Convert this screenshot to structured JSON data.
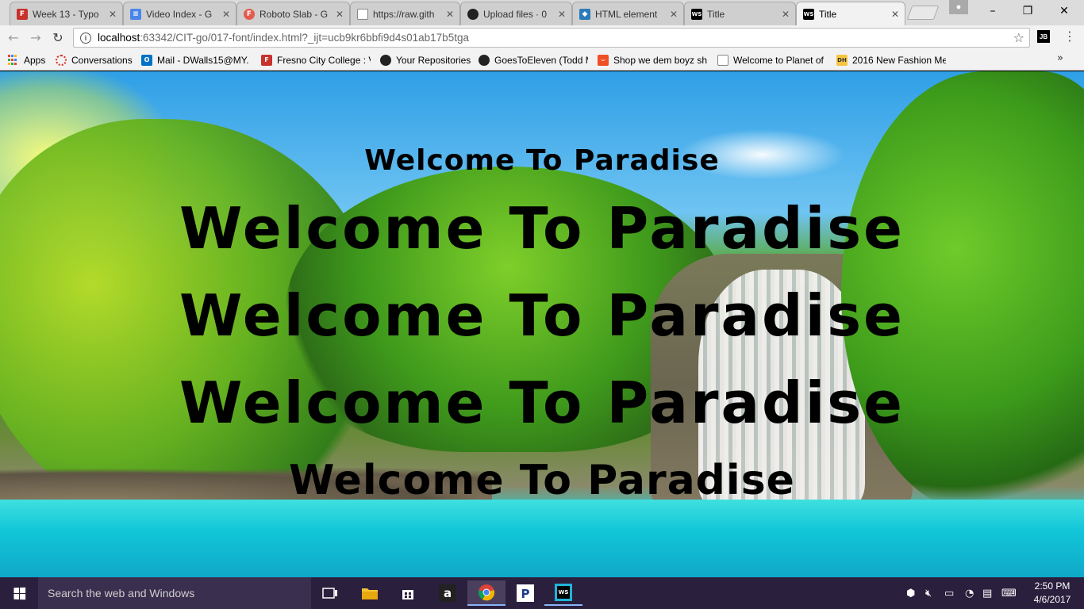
{
  "browser": {
    "tabs": [
      {
        "label": "Week 13 - Typo",
        "icon": "fcc-logo-icon",
        "active": false
      },
      {
        "label": "Video Index - G",
        "icon": "google-docs-icon",
        "active": false
      },
      {
        "label": "Roboto Slab - G",
        "icon": "google-fonts-icon",
        "active": false
      },
      {
        "label": "https://raw.gith",
        "icon": "page-icon",
        "active": false
      },
      {
        "label": "Upload files · 0",
        "icon": "github-icon",
        "active": false
      },
      {
        "label": "HTML element",
        "icon": "html-icon",
        "active": false
      },
      {
        "label": "Title",
        "icon": "webstorm-icon",
        "active": false
      },
      {
        "label": "Title",
        "icon": "webstorm-icon",
        "active": true
      }
    ],
    "address": {
      "host": "localhost",
      "path": ":63342/CIT-go/017-font/index.html?_ijt=ucb9kr6bbfi9d4s01ab17b5tga"
    },
    "extension_label": "JB",
    "bookmarks": [
      {
        "label": "Apps",
        "icon": "apps-grid-icon"
      },
      {
        "label": "Conversations",
        "icon": "conversations-icon"
      },
      {
        "label": "Mail - DWalls15@MY.",
        "icon": "outlook-icon"
      },
      {
        "label": "Fresno City College : V",
        "icon": "fcc-logo-icon"
      },
      {
        "label": "Your Repositories",
        "icon": "github-icon"
      },
      {
        "label": "GoesToEleven (Todd M",
        "icon": "github-icon"
      },
      {
        "label": "Shop we dem boyz sh",
        "icon": "shop-icon"
      },
      {
        "label": "Welcome to Planet of",
        "icon": "page-icon"
      },
      {
        "label": "2016 New Fashion Me",
        "icon": "dh-icon"
      }
    ]
  },
  "page": {
    "headings": [
      "Welcome To Paradise",
      "Welcome To Paradise",
      "Welcome To Paradise",
      "Welcome To Paradise",
      "Welcome To Paradise"
    ]
  },
  "taskbar": {
    "search_placeholder": "Search the web and Windows",
    "time": "2:50 PM",
    "date": "4/6/2017"
  }
}
